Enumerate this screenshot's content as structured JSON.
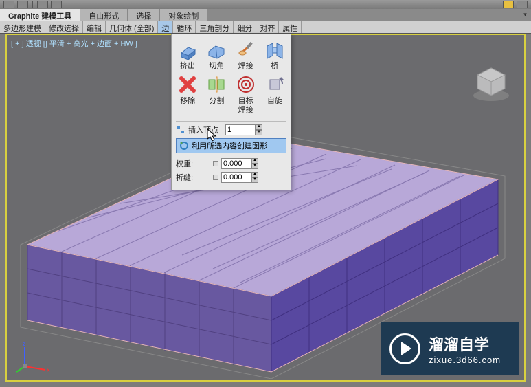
{
  "ribbon": {
    "tabs": [
      "Graphite 建模工具",
      "自由形式",
      "选择",
      "对象绘制"
    ],
    "active": 0,
    "sub_tabs": [
      "多边形建模",
      "修改选择",
      "编辑",
      "几何体 (全部)",
      "边",
      "循环",
      "三角剖分",
      "细分",
      "对齐",
      "属性"
    ],
    "sub_active": 4
  },
  "viewport": {
    "label": "[ + ] 透视 [] 平滑 + 高光 + 边面 + HW ]"
  },
  "popup": {
    "tools_row1": [
      {
        "name": "extrude",
        "label": "挤出"
      },
      {
        "name": "chamfer",
        "label": "切角"
      },
      {
        "name": "weld",
        "label": "焊接"
      },
      {
        "name": "bridge",
        "label": "桥"
      }
    ],
    "tools_row2": [
      {
        "name": "remove",
        "label": "移除"
      },
      {
        "name": "split",
        "label": "分割"
      },
      {
        "name": "target-weld",
        "label": "目标\n焊接"
      },
      {
        "name": "spin",
        "label": "自旋"
      }
    ],
    "insert_vertex": {
      "label": "插入顶点",
      "value": "1"
    },
    "create_shape": {
      "label": "利用所选内容创建图形"
    },
    "weight": {
      "label": "权重:",
      "value": "0.000"
    },
    "crease": {
      "label": "折缝:",
      "value": "0.000"
    }
  },
  "watermark": {
    "title": "溜溜自学",
    "url": "zixue.3d66.com"
  }
}
